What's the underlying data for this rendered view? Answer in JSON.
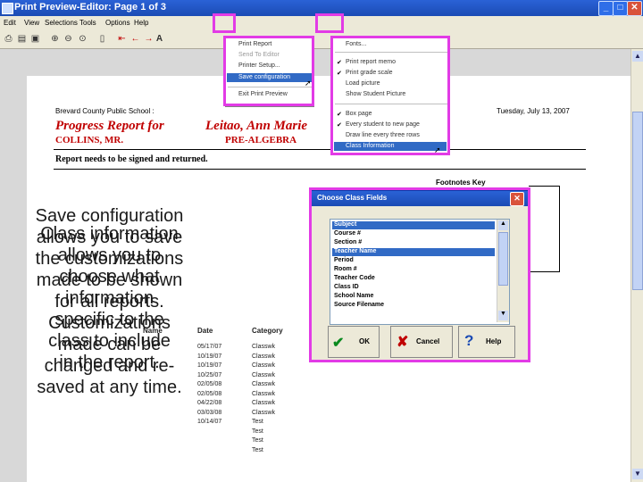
{
  "window": {
    "title": "Print Preview-Editor:  Page 1 of 3"
  },
  "menubar": [
    "Edit",
    "View",
    "Selections",
    "Tools",
    "Options",
    "Help"
  ],
  "file_menu": {
    "items": [
      "Print Report",
      "Send To Editor",
      "Printer Setup...",
      "Save configuration",
      "Exit Print Preview"
    ],
    "selected": "Save configuration"
  },
  "options_menu": {
    "items": [
      "Fonts...",
      "Print report memo",
      "Print grade scale",
      "Load picture",
      "Show Student Picture",
      "Box page",
      "Every student to new page",
      "Draw line every three rows",
      "Class Information"
    ],
    "checked": [
      "Print report memo",
      "Print grade scale",
      "Box page",
      "Every student to new page"
    ],
    "selected": "Class Information"
  },
  "report": {
    "school": "Brevard County Public School :",
    "date": "Tuesday, July 13, 2007",
    "title": "Progress Report for",
    "student": "Leitao, Ann Marie",
    "teacher": "COLLINS, MR.",
    "course": "PRE-ALGEBRA",
    "notice": "Report needs to be signed and returned.",
    "footnotes": "Footnotes Key",
    "table_headers": [
      "Name",
      "Date",
      "Category"
    ],
    "rows": [
      [
        "05/17/07",
        "Classwk"
      ],
      [
        "10/19/07",
        "Classwk"
      ],
      [
        "10/19/07",
        "Classwk"
      ],
      [
        "10/25/07",
        "Classwk"
      ],
      [
        "02/05/08",
        "Classwk"
      ],
      [
        "02/05/08",
        "Classwk"
      ],
      [
        "04/22/08",
        "Classwk"
      ],
      [
        "03/03/08",
        "Classwk"
      ],
      [
        "10/14/07",
        "Test"
      ],
      [
        "",
        "Test"
      ],
      [
        "",
        "Test"
      ],
      [
        "",
        "Test"
      ]
    ]
  },
  "dialog": {
    "title": "Choose Class Fields",
    "fields": [
      "Subject",
      "Course #",
      "Section #",
      "Teacher Name",
      "Period",
      "Room #",
      "Teacher Code",
      "Class ID",
      "School Name",
      "Source Filename"
    ],
    "selected": [
      "Subject",
      "Teacher Name"
    ],
    "ok": "OK",
    "cancel": "Cancel",
    "help": "Help"
  },
  "annotation": {
    "text_a": "Save configuration\nallows you to save\nthe customizations\nmade to be shown\nfor all reports.\nCustomizations\nmade can be\nchanged and re-\nsaved at any time.",
    "text_b": "Class information\nallows you to\nchoose what\ninformation\nspecific to the\nclass to include\nin the report."
  },
  "colors": {
    "highlight": "#e23be6",
    "title_red": "#c00000",
    "menu_select": "#316ac5"
  }
}
